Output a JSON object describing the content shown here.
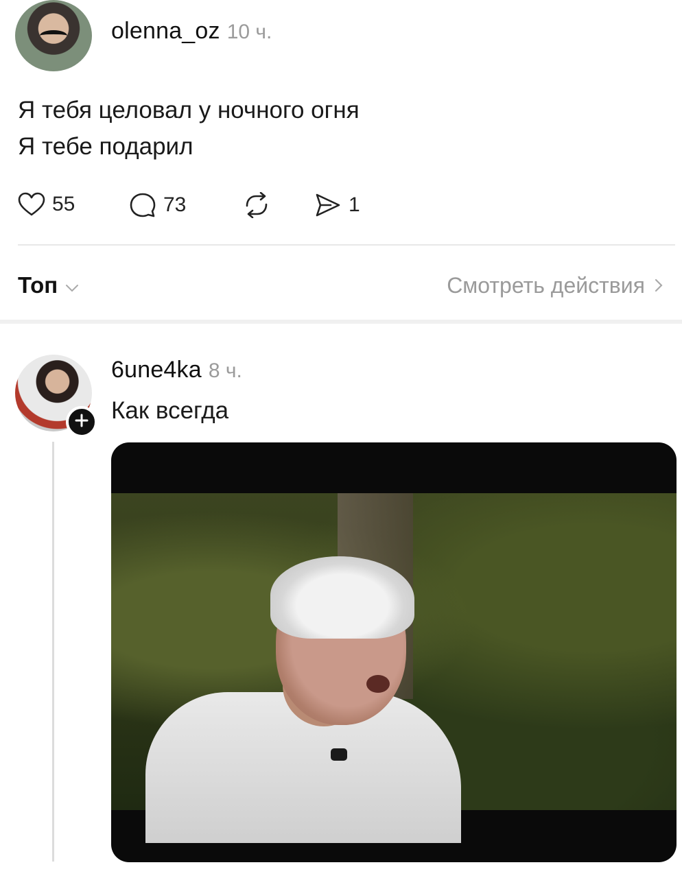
{
  "post": {
    "username": "olenna_oz",
    "time": "10 ч.",
    "lines": [
      "Я тебя целовал у ночного огня",
      "Я тебе подарил"
    ],
    "likes": "55",
    "comments": "73",
    "shares": "1"
  },
  "controls": {
    "sort_label": "Топ",
    "see_actions": "Смотреть действия"
  },
  "reply": {
    "username": "6une4ka",
    "time": "8 ч.",
    "text": "Как всегда"
  },
  "icons": {
    "like": "heart-icon",
    "comment": "comment-bubble-icon",
    "repost": "repost-arrows-icon",
    "share": "paper-plane-icon",
    "sort": "chevron-down-icon",
    "see_actions": "chevron-right-icon",
    "follow": "plus-icon"
  }
}
